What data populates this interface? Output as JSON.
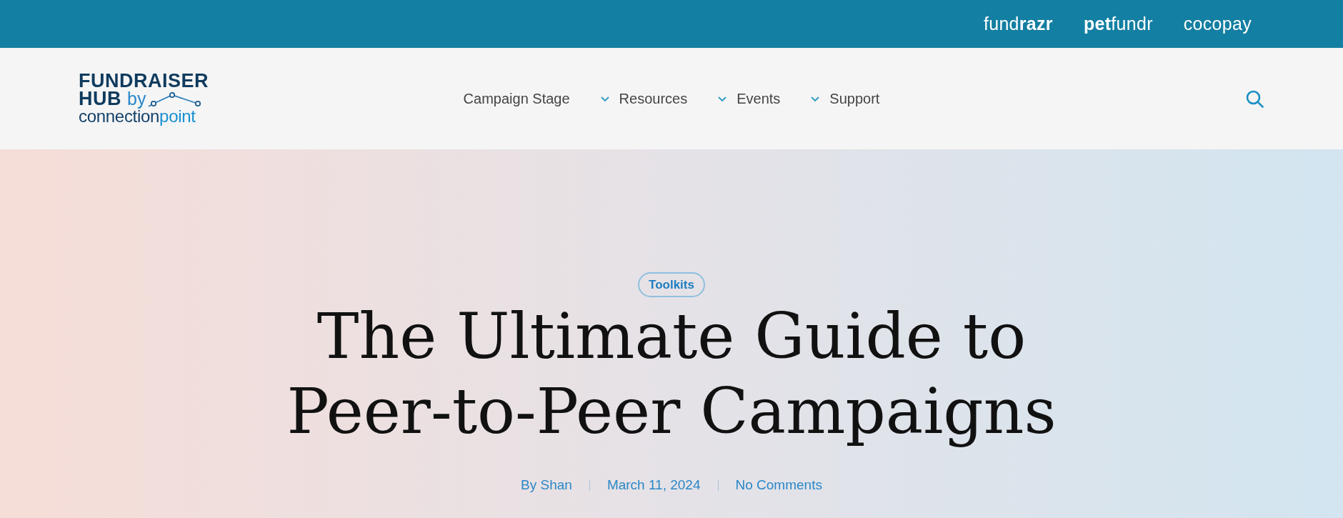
{
  "top_bar": {
    "brands": [
      "fund**razr**",
      "**pet**fundr",
      "cocopay"
    ]
  },
  "header": {
    "logo": {
      "line_1": "FUNDRAISER",
      "line_2": "HUB",
      "by": "by",
      "name_start": "connection",
      "name_end": "point"
    },
    "nav": [
      {
        "label": "Campaign Stage",
        "dropdown": false
      },
      {
        "label": "Resources",
        "dropdown": true
      },
      {
        "label": "Events",
        "dropdown": true
      },
      {
        "label": "Support",
        "dropdown": true
      }
    ]
  },
  "hero": {
    "category": "Toolkits",
    "title": "The Ultimate Guide to Peer-to-Peer Campaigns",
    "meta": [
      "By Shan",
      "March 11, 2024",
      "No Comments"
    ]
  }
}
